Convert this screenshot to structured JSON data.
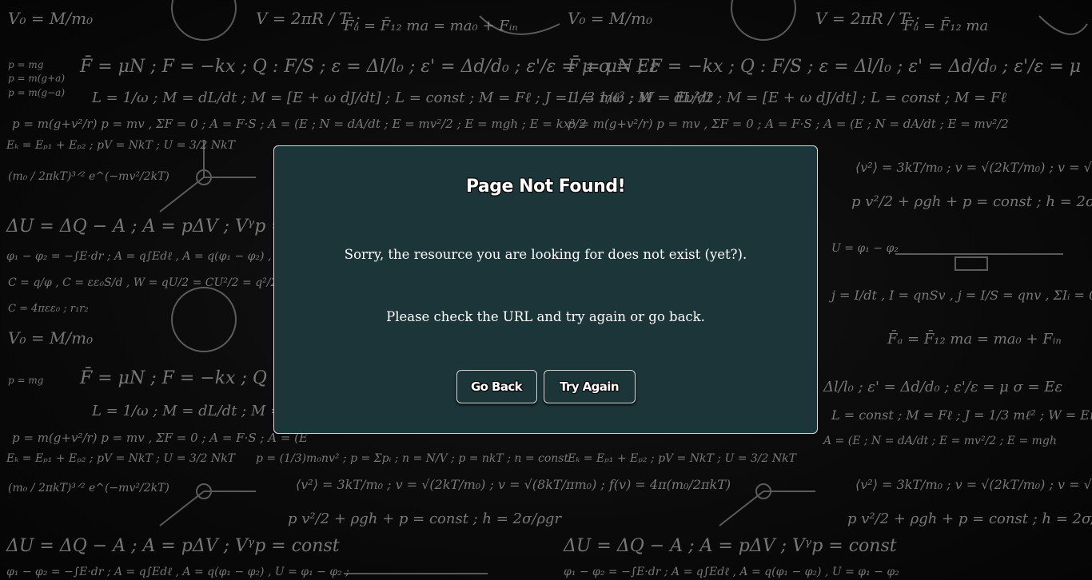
{
  "dialog": {
    "title": "Page Not Found!",
    "message": "Sorry, the resource you are looking for does not exist (yet?).",
    "hint": "Please check the URL and try again or go back."
  },
  "buttons": {
    "go_back": "Go Back",
    "try_again": "Try Again"
  },
  "colors": {
    "dialog_background": "#1c3538",
    "dialog_border": "#d9d9d9",
    "page_background": "#0b0b0b",
    "text": "#ffffff"
  }
}
